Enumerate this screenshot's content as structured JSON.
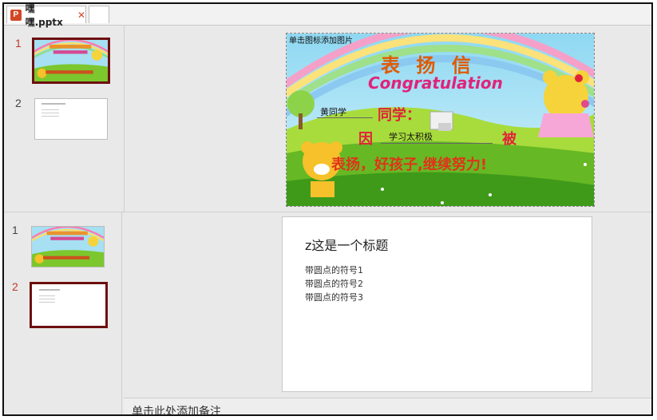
{
  "tab": {
    "filename": "嘿嘿.pptx",
    "icon": "P",
    "close": "✕"
  },
  "slides": [
    {
      "number": "1",
      "placeholder_hint": "单击图标添加图片",
      "heading": "表 扬 信",
      "congrats": "Congratulation",
      "student_name": "黄同学",
      "classmate": "同学：",
      "because": "因",
      "reason": "学习太积极",
      "by": "被",
      "praise": "表扬，好孩子,继续努力!"
    },
    {
      "number": "2",
      "title": "z这是一个标题",
      "bullets": [
        "带圆点的符号1",
        "带圆点的符号2",
        "带圆点的符号3"
      ]
    }
  ],
  "notes_placeholder": "单击此处添加备注",
  "colors": {
    "selected_border": "#6d0f0f",
    "active_number": "#c0392b",
    "heading": "#e05a00",
    "congrats": "#e0237a"
  }
}
